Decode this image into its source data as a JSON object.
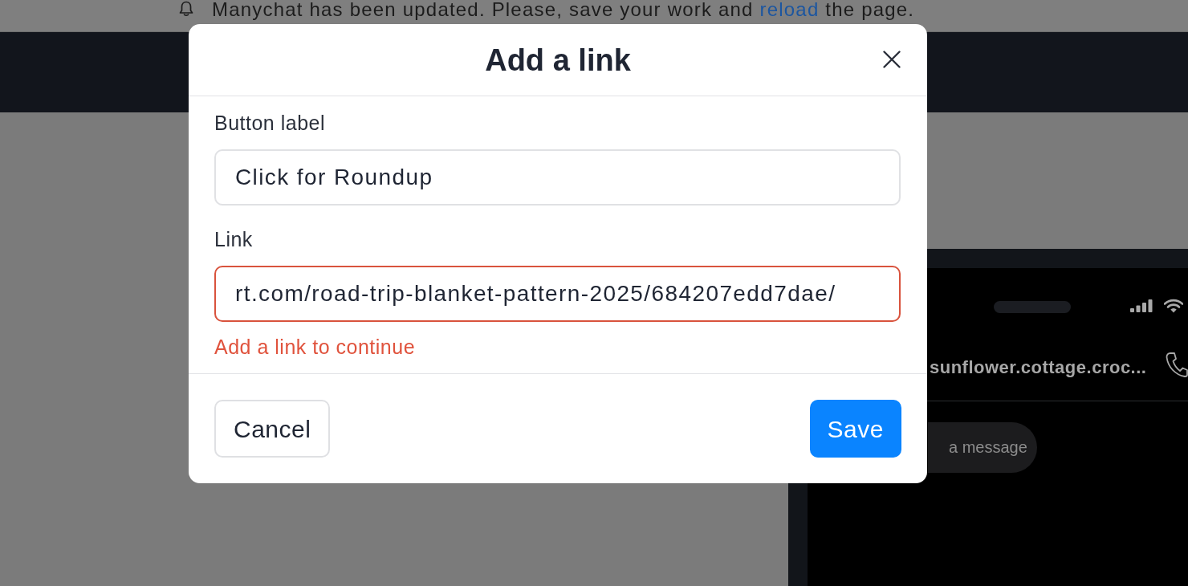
{
  "update_banner": {
    "text_before": "Manychat has been updated. Please, save your work and ",
    "link": "reload",
    "text_after": " the page."
  },
  "modal": {
    "title": "Add a link",
    "fields": [
      {
        "label": "Button label",
        "value": "Click for Roundup",
        "invalid": false
      },
      {
        "label": "Link",
        "value": "rt.com/road-trip-blanket-pattern-2025/684207edd7dae/",
        "invalid": true,
        "error": "Add a link to continue"
      }
    ],
    "buttons": [
      {
        "label": "Cancel",
        "kind": "secondary"
      },
      {
        "label": "Save",
        "kind": "primary"
      }
    ]
  },
  "phone_preview": {
    "contact_name": "sunflower.cottage.croc...",
    "message_field": {
      "placeholder": "a message"
    }
  }
}
